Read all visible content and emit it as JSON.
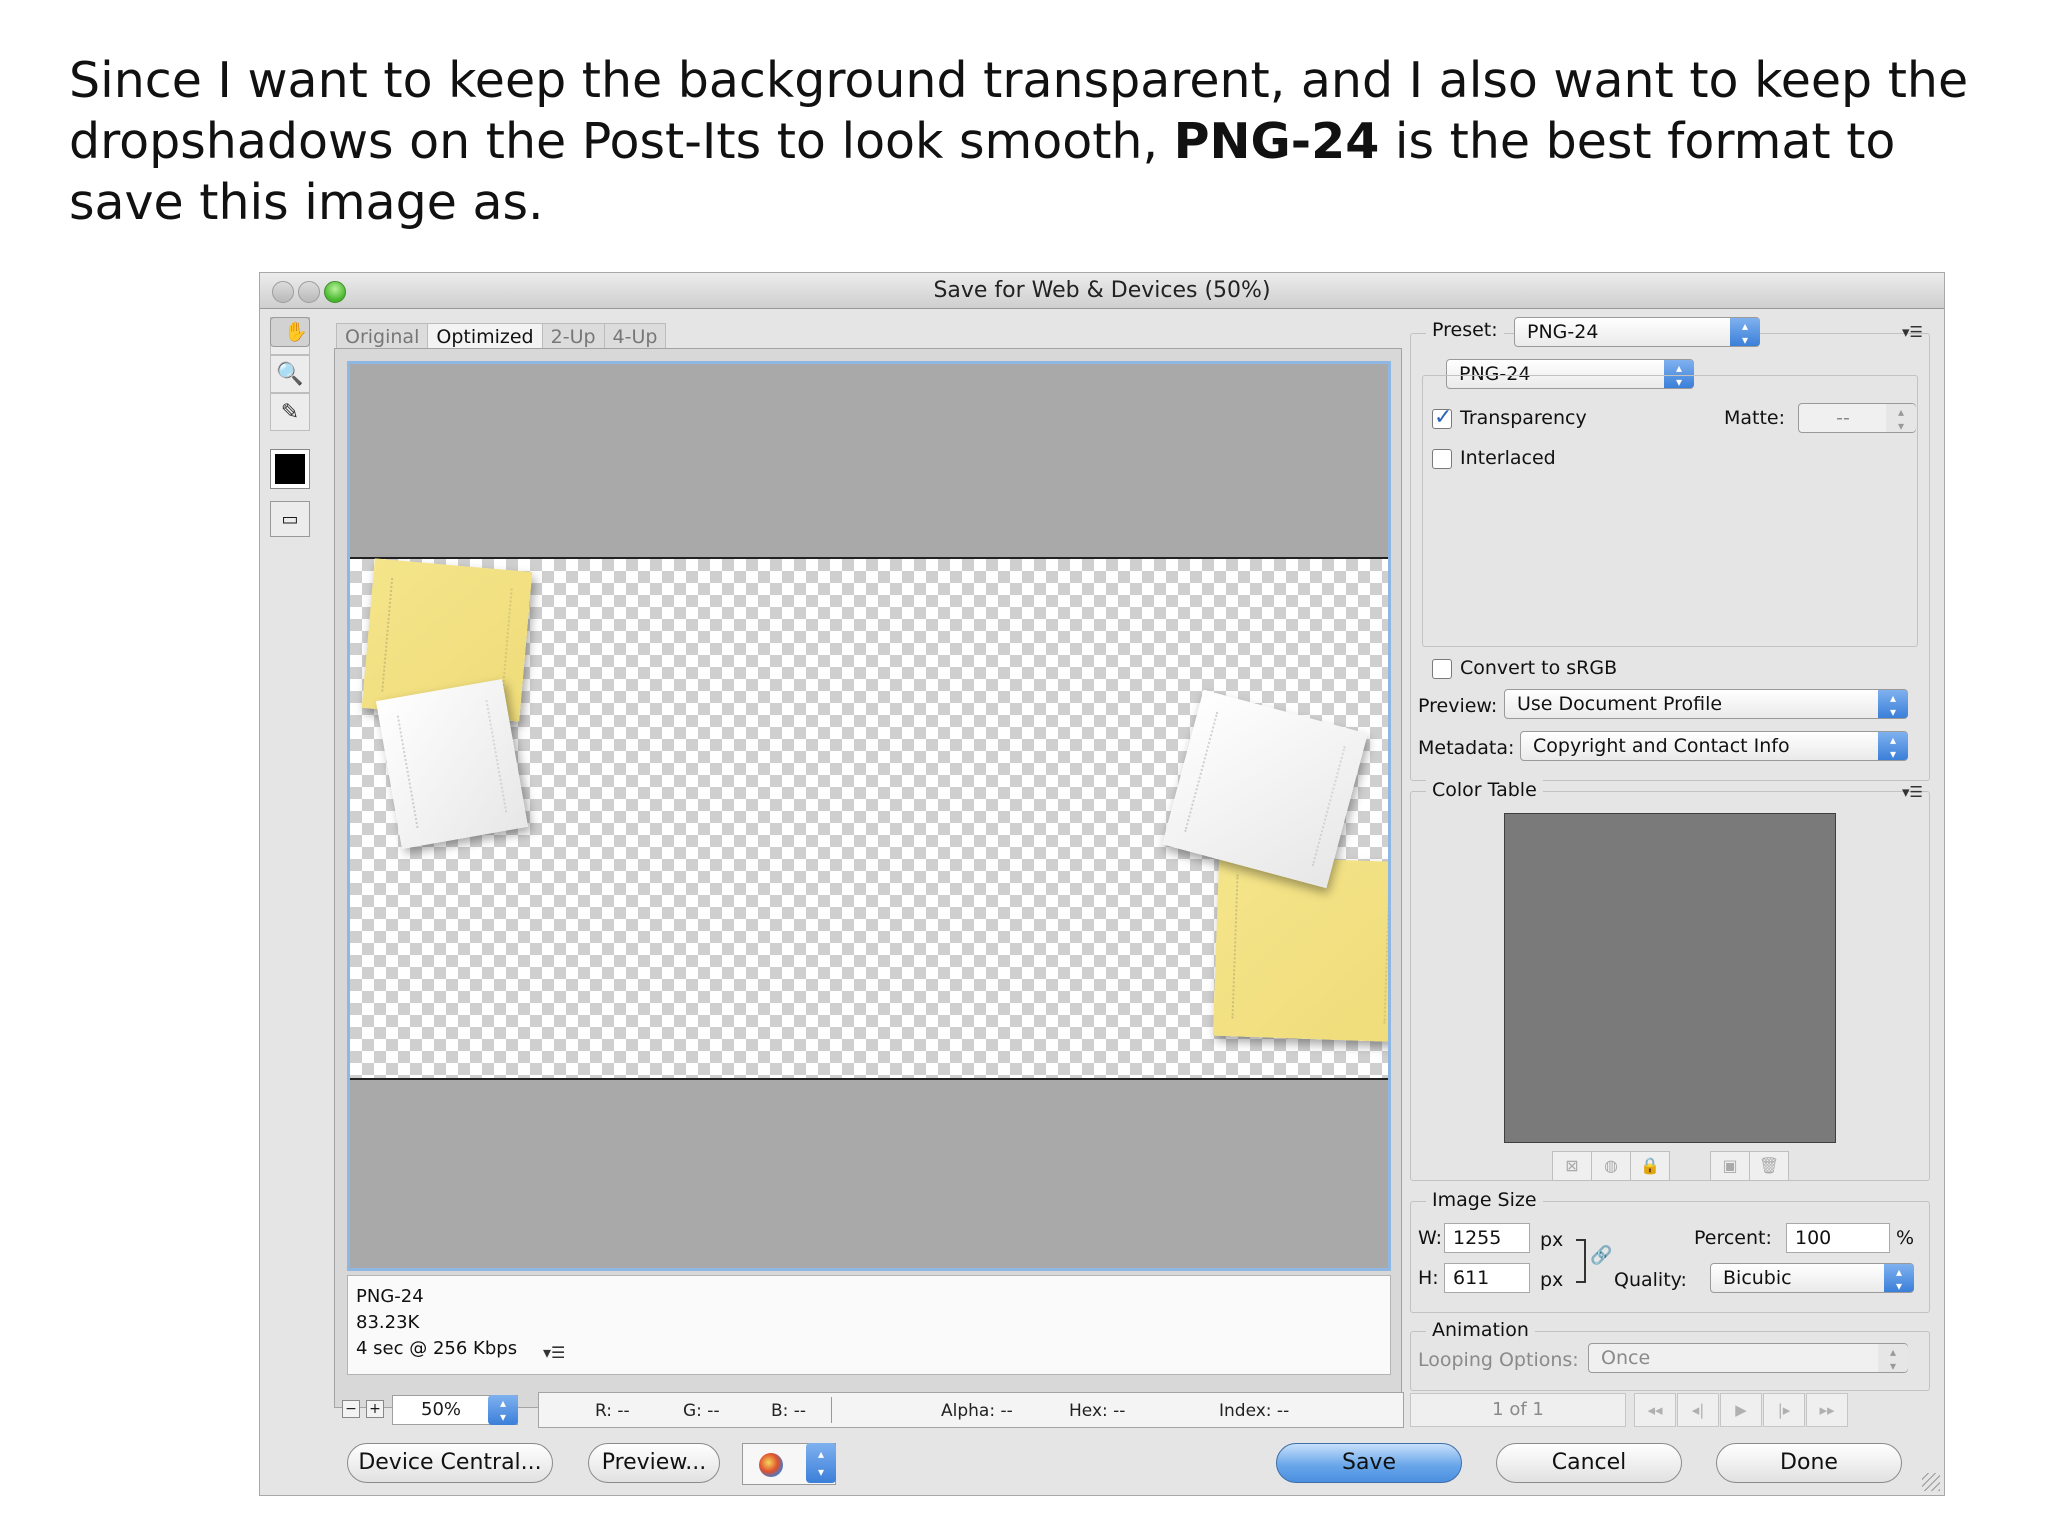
{
  "caption": {
    "before": "Since I want to keep the background transparent, and I also want to keep the dropshadows on the Post-Its to look smooth, ",
    "bold": "PNG-24",
    "after": " is the best format to save this image as."
  },
  "window": {
    "title": "Save for Web & Devices (50%)",
    "tabs": [
      "Original",
      "Optimized",
      "2-Up",
      "4-Up"
    ]
  },
  "preview_info": {
    "format": "PNG-24",
    "size": "83.23K",
    "time": "4 sec @ 256 Kbps"
  },
  "statusbar": {
    "zoom": "50%",
    "r": "R: --",
    "g": "G: --",
    "b": "B: --",
    "alpha": "Alpha: --",
    "hex": "Hex: --",
    "index": "Index: --"
  },
  "buttons": {
    "device_central": "Device Central...",
    "preview": "Preview...",
    "save": "Save",
    "cancel": "Cancel",
    "done": "Done"
  },
  "settings": {
    "preset_label": "Preset:",
    "preset_value": "PNG-24",
    "format_value": "PNG-24",
    "transparency_label": "Transparency",
    "transparency_checked": true,
    "interlaced_label": "Interlaced",
    "matte_label": "Matte:",
    "matte_value": "--",
    "convert_srgb_label": "Convert to sRGB",
    "preview_label": "Preview:",
    "preview_value": "Use Document Profile",
    "metadata_label": "Metadata:",
    "metadata_value": "Copyright and Contact Info"
  },
  "color_table": {
    "title": "Color Table"
  },
  "image_size": {
    "title": "Image Size",
    "w_label": "W:",
    "w_value": "1255",
    "h_label": "H:",
    "h_value": "611",
    "unit": "px",
    "percent_label": "Percent:",
    "percent_value": "100",
    "percent_unit": "%",
    "quality_label": "Quality:",
    "quality_value": "Bicubic"
  },
  "animation": {
    "title": "Animation",
    "looping_label": "Looping Options:",
    "looping_value": "Once",
    "frame_counter": "1 of 1"
  }
}
